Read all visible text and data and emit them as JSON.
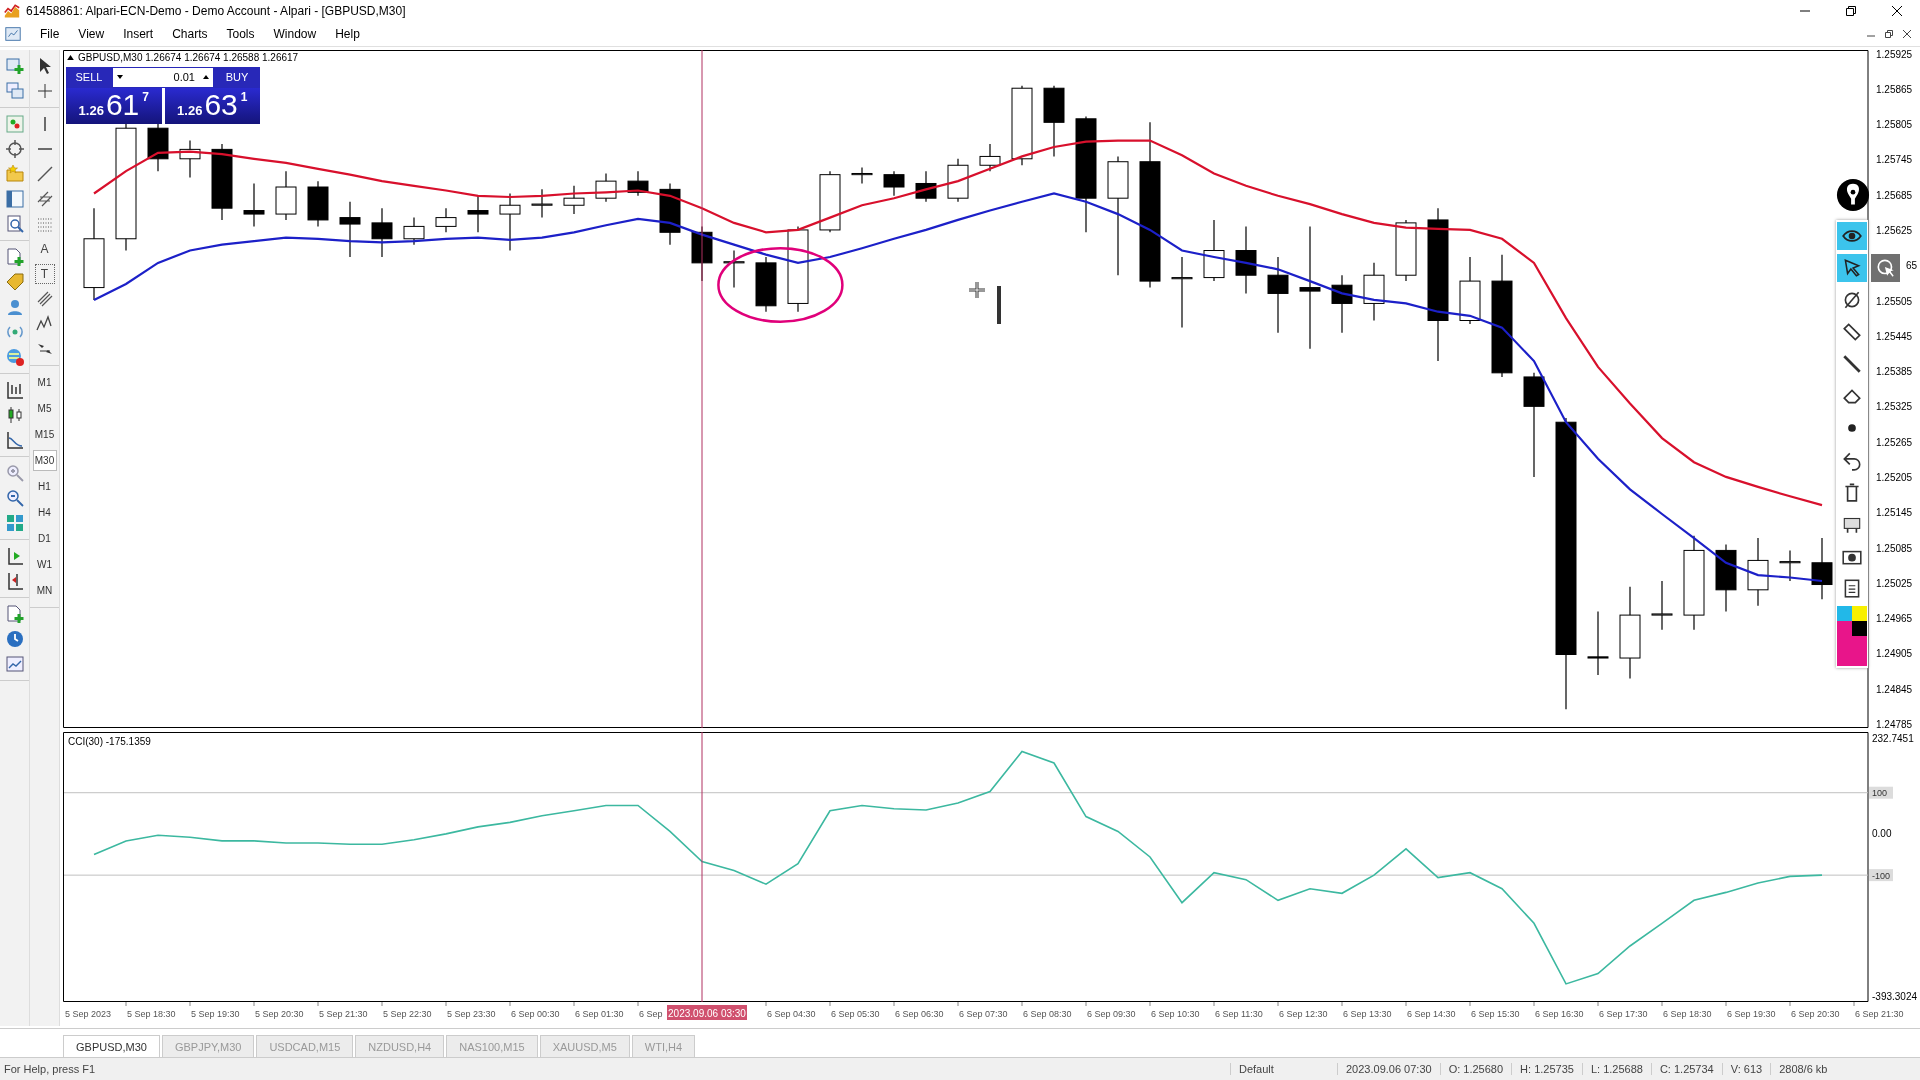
{
  "window": {
    "title": "61458861: Alpari-ECN-Demo - Demo Account - Alpari - [GBPUSD,M30]"
  },
  "menu": [
    "File",
    "View",
    "Insert",
    "Charts",
    "Tools",
    "Window",
    "Help"
  ],
  "text_tools": [
    "A",
    "T"
  ],
  "timeframes": [
    {
      "label": "M1",
      "selected": false
    },
    {
      "label": "M5",
      "selected": false
    },
    {
      "label": "M15",
      "selected": false
    },
    {
      "label": "M30",
      "selected": true
    },
    {
      "label": "H1",
      "selected": false
    },
    {
      "label": "H4",
      "selected": false
    },
    {
      "label": "D1",
      "selected": false
    },
    {
      "label": "W1",
      "selected": false
    },
    {
      "label": "MN",
      "selected": false
    }
  ],
  "chart": {
    "header": "GBPUSD,M30  1.26674 1.26674 1.26588 1.26617",
    "trade_panel": {
      "sell": "SELL",
      "buy": "BUY",
      "lot": "0.01",
      "bid": {
        "big": "1.26",
        "main": "61",
        "small": "7"
      },
      "ask": {
        "big": "1.26",
        "main": "63",
        "small": "1"
      }
    },
    "covered_price_label": "65",
    "crosshair_label": "2023.09.06 03:30",
    "chart_data": {
      "type": "line",
      "ylim": [
        1.24779,
        1.25932
      ],
      "yticks": [
        1.25925,
        1.25865,
        1.25805,
        1.25745,
        1.25685,
        1.25625,
        1.25505,
        1.25445,
        1.25385,
        1.25325,
        1.25265,
        1.25205,
        1.25145,
        1.25085,
        1.25025,
        1.24965,
        1.24905,
        1.24845,
        1.24785
      ],
      "series": [
        {
          "color": "#d8102c",
          "values": [
            1.25688,
            1.25726,
            1.25757,
            1.25759,
            1.25755,
            1.25747,
            1.2574,
            1.2573,
            1.2572,
            1.25709,
            1.25701,
            1.25693,
            1.25684,
            1.25682,
            1.25684,
            1.25688,
            1.2569,
            1.25693,
            1.25684,
            1.25663,
            1.25638,
            1.25622,
            1.25626,
            1.25647,
            1.25668,
            1.2568,
            1.25695,
            1.25709,
            1.2573,
            1.25751,
            1.25767,
            1.25776,
            1.25778,
            1.25778,
            1.25753,
            1.25722,
            1.25701,
            1.25684,
            1.2567,
            1.25653,
            1.25638,
            1.2563,
            1.25628,
            1.25626,
            1.25611,
            1.2557,
            1.25476,
            1.25393,
            1.25331,
            1.25272,
            1.25231,
            1.25206,
            1.25189,
            1.25173,
            1.25158
          ]
        },
        {
          "color": "#1c20c8",
          "values": [
            1.25507,
            1.25534,
            1.2557,
            1.25591,
            1.25601,
            1.25607,
            1.25613,
            1.25611,
            1.25607,
            1.25605,
            1.25607,
            1.25611,
            1.25613,
            1.25609,
            1.25613,
            1.25622,
            1.25634,
            1.25645,
            1.25638,
            1.25618,
            1.25601,
            1.25584,
            1.2557,
            1.2558,
            1.25595,
            1.25611,
            1.25626,
            1.25643,
            1.25659,
            1.25674,
            1.25688,
            1.25674,
            1.25653,
            1.25626,
            1.25591,
            1.2558,
            1.2557,
            1.25559,
            1.25539,
            1.25518,
            1.25507,
            1.25501,
            1.25487,
            1.2548,
            1.2546,
            1.25403,
            1.25299,
            1.25237,
            1.25185,
            1.25143,
            1.25102,
            1.2506,
            1.25039,
            1.25035,
            1.25029
          ]
        }
      ]
    }
  },
  "indicator": {
    "header": "CCI(30) -175.1359",
    "chart_data": {
      "type": "line",
      "ylim": [
        -407.86,
        247.31
      ],
      "yticks": [
        232.7451,
        100,
        {
          "value": 0,
          "label": "0.00"
        },
        -100,
        -393.3024
      ],
      "series": [
        {
          "color": "#3cb8a0",
          "values": [
            -50,
            -17,
            -3,
            -8,
            -17,
            -17,
            -22,
            -22,
            -25,
            -25,
            -14,
            0,
            17,
            28,
            44,
            56,
            69,
            69,
            6,
            -67,
            -89,
            -122,
            -72,
            56,
            69,
            61,
            58,
            75,
            103,
            200,
            172,
            42,
            6,
            -56,
            -167,
            -94,
            -111,
            -161,
            -133,
            -144,
            -100,
            -36,
            -106,
            -94,
            -133,
            -217,
            -364,
            -339,
            -272,
            -217,
            -161,
            -142,
            -119,
            -103,
            -100
          ]
        }
      ],
      "ref_lines": [
        {
          "axis": "y",
          "value": 100
        },
        {
          "axis": "y",
          "value": -100
        }
      ]
    }
  },
  "time_axis": [
    "5 Sep 2023",
    "5 Sep 18:30",
    "5 Sep 19:30",
    "5 Sep 20:30",
    "5 Sep 21:30",
    "5 Sep 22:30",
    "5 Sep 23:30",
    "6 Sep 00:30",
    "6 Sep 01:30",
    "6 Sep",
    "6 Sep 04:30",
    "6 Sep 05:30",
    "6 Sep 06:30",
    "6 Sep 07:30",
    "6 Sep 08:30",
    "6 Sep 09:30",
    "6 Sep 10:30",
    "6 Sep 11:30",
    "6 Sep 12:30",
    "6 Sep 13:30",
    "6 Sep 14:30",
    "6 Sep 15:30",
    "6 Sep 16:30",
    "6 Sep 17:30",
    "6 Sep 18:30",
    "6 Sep 19:30",
    "6 Sep 20:30",
    "6 Sep 21:30"
  ],
  "drawing_toolbar": [
    {
      "selected": true
    },
    {
      "selected": true
    },
    {
      "selected": false
    },
    {
      "selected": false
    },
    {
      "selected": false
    },
    {
      "selected": false
    },
    {
      "selected": false
    },
    {
      "selected": false
    },
    {
      "selected": false
    },
    {
      "selected": false
    },
    {
      "selected": false
    },
    {
      "selected": false
    }
  ],
  "tabs": [
    {
      "label": "GBPUSD,M30",
      "selected": true
    },
    {
      "label": "GBPJPY,M30",
      "selected": false
    },
    {
      "label": "USDCAD,M15",
      "selected": false
    },
    {
      "label": "NZDUSD,H4",
      "selected": false
    },
    {
      "label": "NAS100,M15",
      "selected": false
    },
    {
      "label": "XAUUSD,M5",
      "selected": false
    },
    {
      "label": "WTI,H4",
      "selected": false
    }
  ],
  "status_bar": {
    "help": "For Help, press F1",
    "items": [
      "Default",
      "2023.09.06 07:30",
      "O: 1.25680",
      "H: 1.25735",
      "L: 1.25688",
      "C: 1.25734",
      "V: 613",
      "2808/6 kb"
    ]
  }
}
